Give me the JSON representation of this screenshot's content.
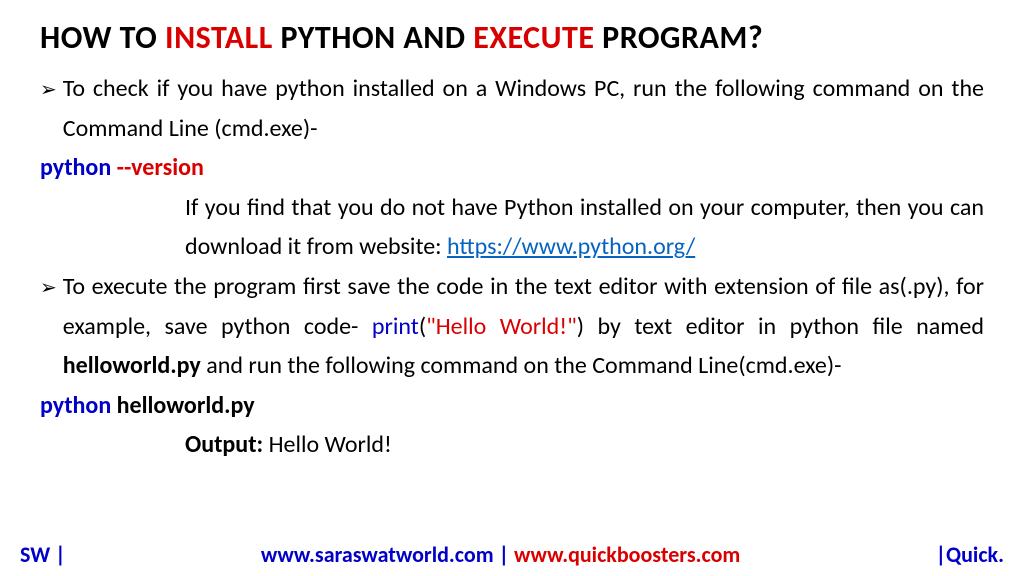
{
  "title": {
    "prefix": "HOW TO ",
    "install": "INSTALL",
    "middle": " PYTHON AND ",
    "execute": "EXECUTE",
    "suffix": " PROGRAM?"
  },
  "bullet_arrow": "➢",
  "bullet1_text": "To check if you have python installed on a Windows PC, run the following command on the Command Line (cmd.exe)-",
  "cmd1": {
    "python": "python ",
    "flag": "--version"
  },
  "download_text": {
    "line1": "If you find that you do not have Python installed on your computer, then you can download it from website: ",
    "link": "https://www.python.org/"
  },
  "bullet2": {
    "pre": "To execute the program first save the code in the text editor with extension of file as(.py), for example, save python code- ",
    "print_word": "print",
    "paren_open": "(",
    "hello_str": "\"Hello World!\"",
    "paren_close": ")",
    "after": " by text editor in python file named ",
    "filename": "helloworld.py",
    "tail": " and run the following command on the Command Line(cmd.exe)-"
  },
  "cmd2": {
    "python": "python ",
    "file": "helloworld.py"
  },
  "output": {
    "label": "Output: ",
    "value": "Hello World!"
  },
  "footer": {
    "left": "SW |",
    "center_blue": "www.saraswatworld.com | ",
    "center_red": "www.quickboosters.com",
    "right": "|Quick."
  }
}
